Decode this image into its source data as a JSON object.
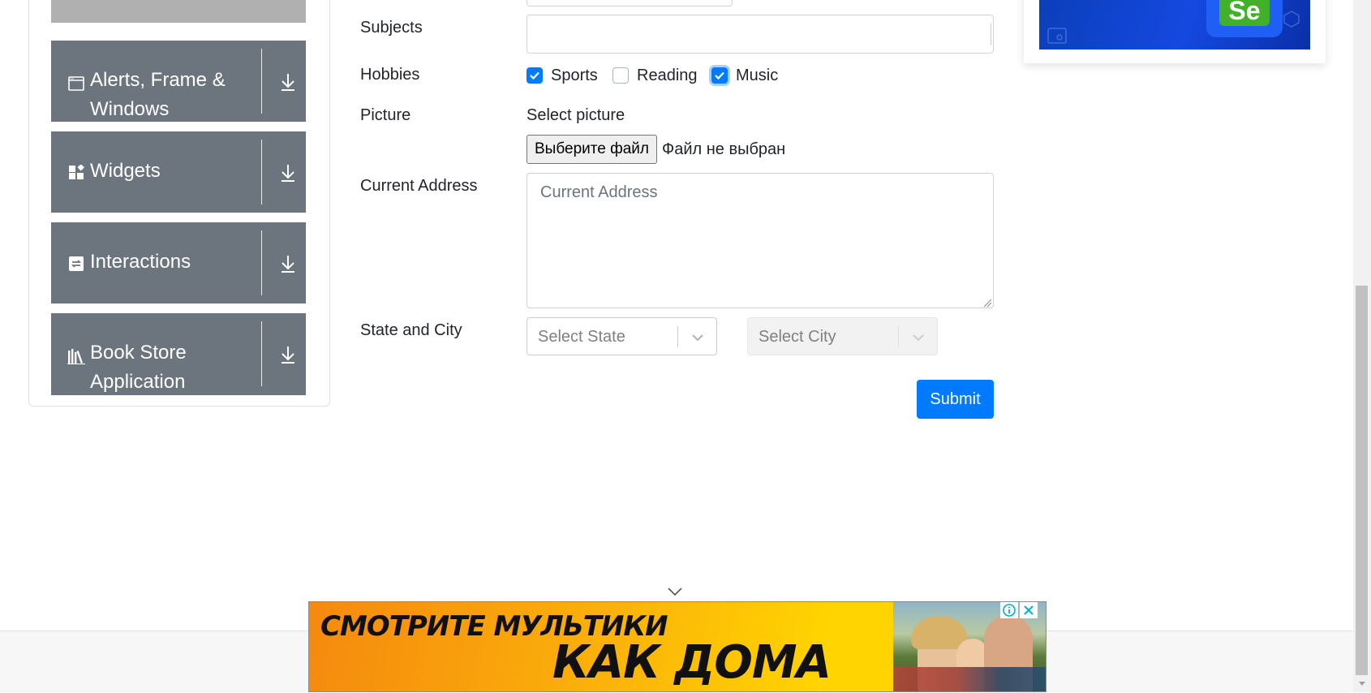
{
  "sidebar": {
    "groups": [
      {
        "id": "alerts",
        "title": "Alerts, Frame & Windows",
        "icon": "window-icon"
      },
      {
        "id": "widgets",
        "title": "Widgets",
        "icon": "widgets-icon"
      },
      {
        "id": "interactions",
        "title": "Interactions",
        "icon": "interactions-icon"
      },
      {
        "id": "bookstore",
        "title": "Book Store Application",
        "icon": "books-icon"
      }
    ]
  },
  "form": {
    "subjects_label": "Subjects",
    "hobbies_label": "Hobbies",
    "hobbies": [
      {
        "label": "Sports",
        "checked": true
      },
      {
        "label": "Reading",
        "checked": false
      },
      {
        "label": "Music",
        "checked": true
      }
    ],
    "picture_label": "Picture",
    "picture_caption": "Select picture",
    "file_button": "Выберите файл",
    "file_status": "Файл не выбран",
    "address_label": "Current Address",
    "address_placeholder": "Current Address",
    "state_city_label": "State and City",
    "state_placeholder": "Select State",
    "city_placeholder": "Select City",
    "submit": "Submit"
  },
  "ads": {
    "right_badge": "Se",
    "bottom_line1": "СМОТРИТЕ МУЛЬТИКИ",
    "bottom_line2": "КАК ДОМА"
  },
  "colors": {
    "primary": "#007bff",
    "sidebar_group": "#6c757d",
    "selenium_green": "#43b02a"
  }
}
